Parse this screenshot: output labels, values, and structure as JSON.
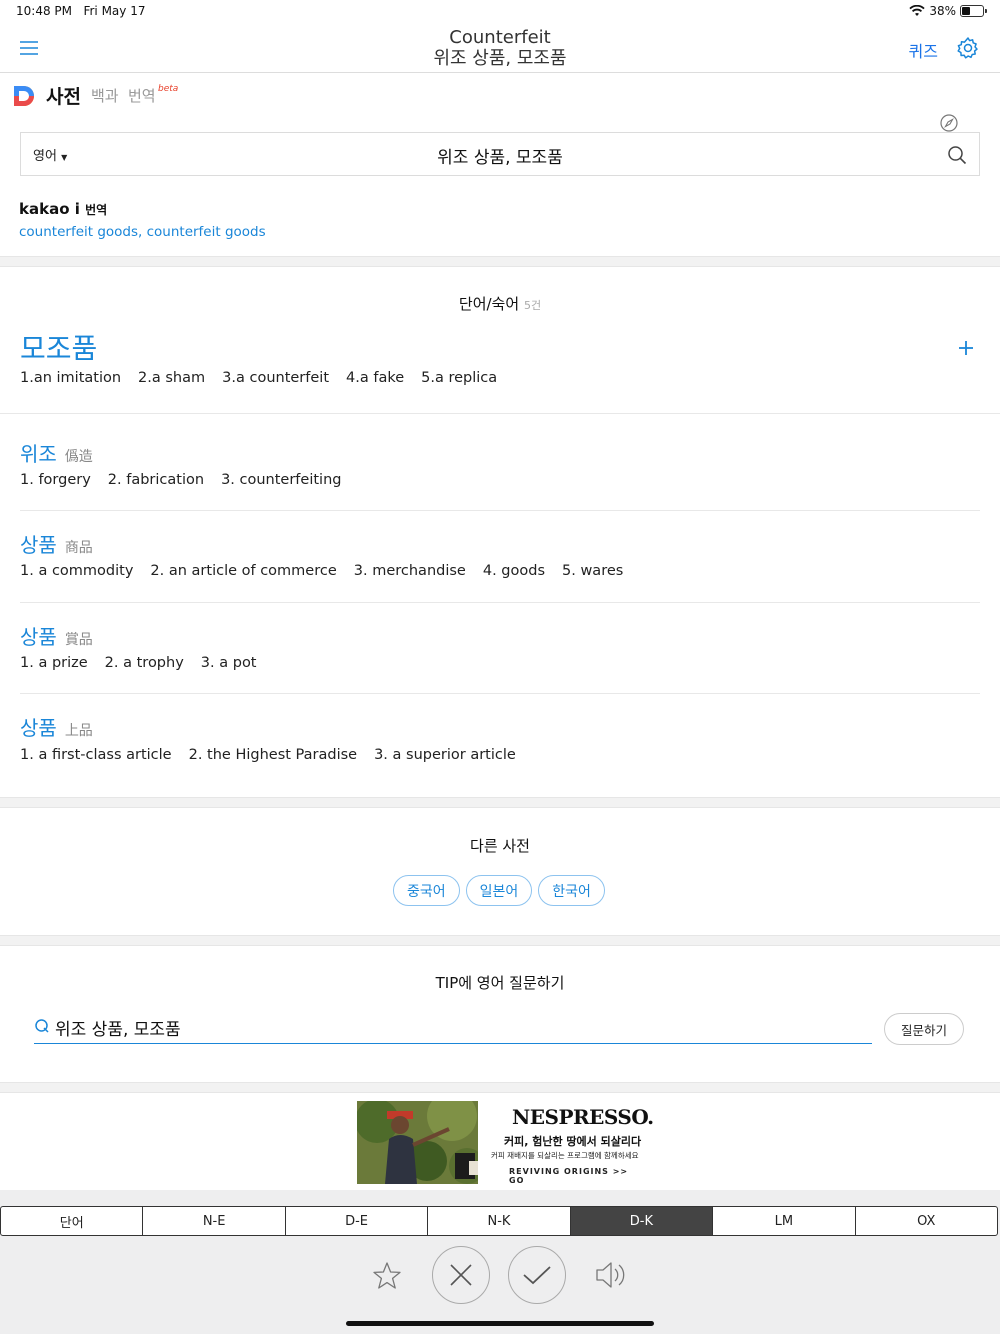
{
  "status": {
    "time": "10:48 PM",
    "date": "Fri May 17",
    "battery": "38%",
    "battery_level": 0.38
  },
  "nav": {
    "title": "Counterfeit",
    "subtitle": "위조 상품, 모조품",
    "quiz": "퀴즈"
  },
  "dict_header": {
    "dict": "사전",
    "tab_encyclopedia": "백과",
    "tab_translate": "번역",
    "beta": "beta"
  },
  "search": {
    "lang": "영어",
    "query": "위조 상품, 모조품"
  },
  "kakao": {
    "brand": "kakao i",
    "brand_sub": "번역",
    "translation": "counterfeit goods, counterfeit goods"
  },
  "words_section": {
    "title": "단어/숙어",
    "count": "5건"
  },
  "main_entry": {
    "word": "모조품",
    "meanings": [
      "1.an imitation",
      "2.a sham",
      "3.a counterfeit",
      "4.a fake",
      "5.a replica"
    ]
  },
  "entries": [
    {
      "word": "위조",
      "hanja": "僞造",
      "meanings": [
        "1. forgery",
        "2. fabrication",
        "3. counterfeiting"
      ]
    },
    {
      "word": "상품",
      "hanja": "商品",
      "meanings": [
        "1. a commodity",
        "2. an article of commerce",
        "3. merchandise",
        "4. goods",
        "5. wares"
      ]
    },
    {
      "word": "상품",
      "hanja": "賞品",
      "meanings": [
        "1. a prize",
        "2. a trophy",
        "3. a pot"
      ]
    },
    {
      "word": "상품",
      "hanja": "上品",
      "meanings": [
        "1. a first-class article",
        "2. the Highest Paradise",
        "3. a superior article"
      ]
    }
  ],
  "other_dicts": {
    "title": "다른 사전",
    "items": [
      "중국어",
      "일본어",
      "한국어"
    ]
  },
  "tip": {
    "title": "TIP에 영어 질문하기",
    "value": "위조 상품, 모조품",
    "ask": "질문하기"
  },
  "ad": {
    "brand": "NESPRESSO.",
    "line1": "커피, 험난한 땅에서 되살리다",
    "line2": "커피 재배지를 되살리는 프로그램에 함께하세요",
    "line3": "REVIVING ORIGINS >> GO"
  },
  "segments": {
    "items": [
      "단어",
      "N-E",
      "D-E",
      "N-K",
      "D-K",
      "LM",
      "OX"
    ],
    "active": "D-K"
  }
}
